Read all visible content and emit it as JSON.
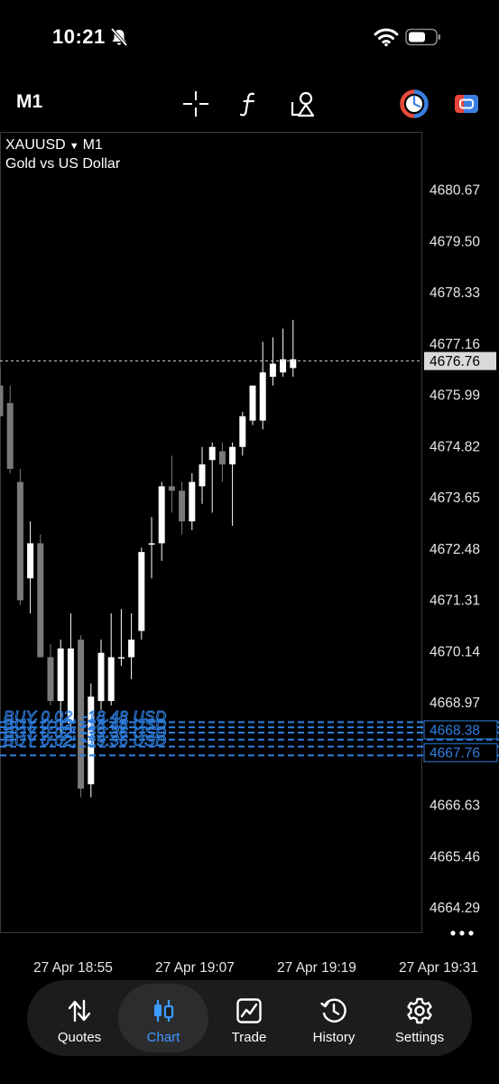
{
  "status": {
    "time": "10:21"
  },
  "toolbar": {
    "timeframe": "M1"
  },
  "symbol": {
    "name": "XAUUSD",
    "timeframe": "M1",
    "description": "Gold vs US Dollar"
  },
  "chart_data": {
    "type": "candlestick",
    "title": "XAUUSD M1",
    "subtitle": "Gold vs US Dollar",
    "yaxis_ticks": [
      4680.67,
      4679.5,
      4678.33,
      4677.16,
      4675.99,
      4674.82,
      4673.65,
      4672.48,
      4671.31,
      4670.14,
      4668.97,
      4667.8,
      4666.63,
      4665.46,
      4664.29
    ],
    "yaxis_tick_labels": [
      "4680.67",
      "4679.50",
      "4678.33",
      "4677.16",
      "4675.99",
      "4674.82",
      "4673.65",
      "4672.48",
      "4671.31",
      "4670.14",
      "4668.97",
      "4667.80",
      "4666.63",
      "4665.46",
      "4664.29"
    ],
    "ylim": [
      4663.8,
      4681.4
    ],
    "xaxis_labels": [
      "27 Apr 18:55",
      "27 Apr 19:07",
      "27 Apr 19:19",
      "27 Apr 19:31"
    ],
    "current_price": "4676.76",
    "position_prices": [
      "4668.38",
      "4667.76"
    ],
    "position_lines": [
      4668.52,
      4668.4,
      4668.28,
      4668.12,
      4667.96,
      4667.76
    ],
    "position_labels": [
      "BUY 0.02, -18.48 USD",
      "BUY 0.02, -18.48 USD",
      "BUY 0.02, -19.36 USD",
      "BUY 0.02, -19.36 USD"
    ],
    "grid": false,
    "candles": [
      {
        "o": 4676.2,
        "h": 4676.6,
        "l": 4675.5,
        "c": 4675.5
      },
      {
        "o": 4675.8,
        "h": 4676.2,
        "l": 4674.2,
        "c": 4674.3
      },
      {
        "o": 4674.0,
        "h": 4674.3,
        "l": 4671.2,
        "c": 4671.3
      },
      {
        "o": 4671.8,
        "h": 4673.1,
        "l": 4671.0,
        "c": 4672.6
      },
      {
        "o": 4672.6,
        "h": 4672.8,
        "l": 4670.0,
        "c": 4670.0
      },
      {
        "o": 4670.0,
        "h": 4670.3,
        "l": 4668.9,
        "c": 4669.0
      },
      {
        "o": 4669.0,
        "h": 4670.4,
        "l": 4668.3,
        "c": 4670.2
      },
      {
        "o": 4668.5,
        "h": 4671.0,
        "l": 4668.3,
        "c": 4670.2
      },
      {
        "o": 4670.4,
        "h": 4670.5,
        "l": 4666.8,
        "c": 4667.0
      },
      {
        "o": 4667.1,
        "h": 4669.4,
        "l": 4666.8,
        "c": 4669.1
      },
      {
        "o": 4669.0,
        "h": 4670.4,
        "l": 4668.8,
        "c": 4670.1
      },
      {
        "o": 4669.0,
        "h": 4671.0,
        "l": 4668.9,
        "c": 4670.0
      },
      {
        "o": 4670.0,
        "h": 4671.1,
        "l": 4669.8,
        "c": 4670.0
      },
      {
        "o": 4670.0,
        "h": 4671.0,
        "l": 4669.5,
        "c": 4670.4
      },
      {
        "o": 4670.6,
        "h": 4672.5,
        "l": 4670.4,
        "c": 4672.4
      },
      {
        "o": 4672.6,
        "h": 4673.2,
        "l": 4671.8,
        "c": 4672.6
      },
      {
        "o": 4672.6,
        "h": 4674.0,
        "l": 4672.2,
        "c": 4673.9
      },
      {
        "o": 4673.9,
        "h": 4674.6,
        "l": 4673.3,
        "c": 4673.8
      },
      {
        "o": 4673.8,
        "h": 4674.0,
        "l": 4672.8,
        "c": 4673.1
      },
      {
        "o": 4673.1,
        "h": 4674.2,
        "l": 4672.9,
        "c": 4674.0
      },
      {
        "o": 4673.9,
        "h": 4674.8,
        "l": 4673.5,
        "c": 4674.4
      },
      {
        "o": 4674.5,
        "h": 4674.9,
        "l": 4673.3,
        "c": 4674.8
      },
      {
        "o": 4674.7,
        "h": 4674.9,
        "l": 4674.0,
        "c": 4674.4
      },
      {
        "o": 4674.4,
        "h": 4674.9,
        "l": 4673.0,
        "c": 4674.8
      },
      {
        "o": 4674.8,
        "h": 4675.6,
        "l": 4674.6,
        "c": 4675.5
      },
      {
        "o": 4675.4,
        "h": 4676.0,
        "l": 4675.3,
        "c": 4676.2
      },
      {
        "o": 4675.4,
        "h": 4677.2,
        "l": 4675.2,
        "c": 4676.5
      },
      {
        "o": 4676.4,
        "h": 4677.3,
        "l": 4676.2,
        "c": 4676.7
      },
      {
        "o": 4676.5,
        "h": 4677.5,
        "l": 4676.4,
        "c": 4676.8
      },
      {
        "o": 4676.6,
        "h": 4677.7,
        "l": 4676.4,
        "c": 4676.8
      }
    ]
  },
  "tabs": [
    {
      "label": "Quotes",
      "icon": "arrows-updown-icon"
    },
    {
      "label": "Chart",
      "icon": "candlestick-icon"
    },
    {
      "label": "Trade",
      "icon": "trade-chart-icon"
    },
    {
      "label": "History",
      "icon": "history-clock-icon"
    },
    {
      "label": "Settings",
      "icon": "gear-icon"
    }
  ],
  "active_tab": "Chart",
  "colors": {
    "background": "#000000",
    "accent": "#3d9bff",
    "position_line": "#2f7fe0",
    "bull_candle": "#ffffff",
    "bear_candle": "#7a7a7a",
    "tabbar": "#1c1c1e"
  }
}
